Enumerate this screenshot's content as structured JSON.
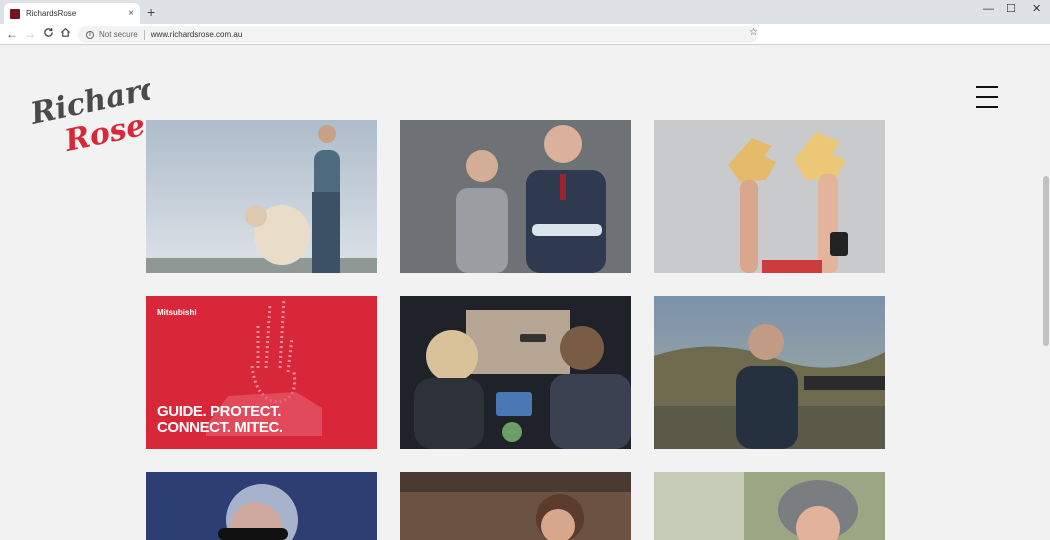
{
  "browser": {
    "tab_title": "RichardsRose",
    "tab_close": "×",
    "new_tab": "+",
    "minimize": "—",
    "maximize": "☐",
    "close": "✕",
    "back": "←",
    "forward": "→",
    "reload": "C",
    "home": "⌂",
    "info_icon": "i",
    "security_label": "Not secure",
    "url": "www.richardsrose.com.au",
    "bookmark": "☆"
  },
  "site": {
    "logo_line1": "Richards",
    "logo_line2": "Rose",
    "menu_icon": "hamburger-menu-icon"
  },
  "tiles": [
    {
      "name": "man-with-sheep"
    },
    {
      "name": "boy-and-older-man"
    },
    {
      "name": "hands-holding-awards"
    },
    {
      "name": "mitsubishi-ad",
      "brand": "Mitsubishi",
      "line1": "GUIDE. PROTECT.",
      "line2": "CONNECT. MITEC."
    },
    {
      "name": "couple-in-car"
    },
    {
      "name": "hiker-on-mountain"
    },
    {
      "name": "woman-with-sunglasses"
    },
    {
      "name": "woman-smiling"
    },
    {
      "name": "child-in-helmet"
    }
  ],
  "colors": {
    "brand_red": "#d9273a",
    "logo_grey": "#4a4a4a",
    "page_bg": "#f2f2f2"
  }
}
